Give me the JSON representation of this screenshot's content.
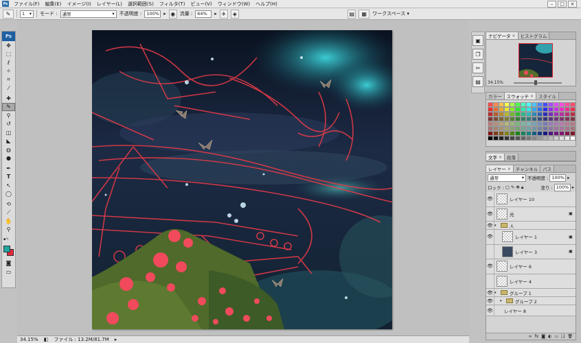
{
  "menubar": {
    "app_icon": "Ps",
    "items": [
      "ファイル(F)",
      "編集(E)",
      "イメージ(I)",
      "レイヤー(L)",
      "選択範囲(S)",
      "フィルタ(T)",
      "ビュー(V)",
      "ウィンドウ(W)",
      "ヘルプ(H)"
    ],
    "win_min": "–",
    "win_max": "□",
    "win_close": "×"
  },
  "options": {
    "brush_size": "1",
    "mode_label": "モード :",
    "mode_value": "通常",
    "opacity_label": "不透明度 :",
    "opacity_value": "100%",
    "flow_label": "流量 :",
    "flow_value": "64%",
    "workspace_label": "ワークスペース ▾"
  },
  "toolbox": {
    "logo": "Ps"
  },
  "status": {
    "zoom": "34.15%",
    "file_info": "ファイル : 13.2M/81.7M"
  },
  "navigator": {
    "tabs": [
      "ナビゲータ",
      "ヒストグラム"
    ],
    "zoom": "34.15%"
  },
  "color_panel": {
    "tabs": [
      "カラー",
      "スウォッチ",
      "スタイル"
    ]
  },
  "char_panel": {
    "tabs": [
      "文字",
      "段落"
    ]
  },
  "layers": {
    "tabs": [
      "レイヤー",
      "チャンネル",
      "パス"
    ],
    "blend_mode": "通常",
    "opacity_label": "不透明度 :",
    "opacity_value": "100%",
    "lock_label": "ロック :",
    "fill_label": "塗り :",
    "fill_value": "100%",
    "rows": [
      {
        "name": "レイヤー 10"
      },
      {
        "name": "光"
      },
      {
        "name": "人"
      },
      {
        "name": "レイヤー 1"
      },
      {
        "name": "レイヤー 3"
      },
      {
        "name": "レイヤー 6"
      },
      {
        "name": "レイヤー 4"
      },
      {
        "name": "グループ 1"
      },
      {
        "name": "グループ 2"
      },
      {
        "name": "レイヤー 8"
      }
    ]
  },
  "colors": {
    "fg": "#1fa6a0",
    "bg": "#e8283c",
    "accent_red": "#e23a48"
  }
}
